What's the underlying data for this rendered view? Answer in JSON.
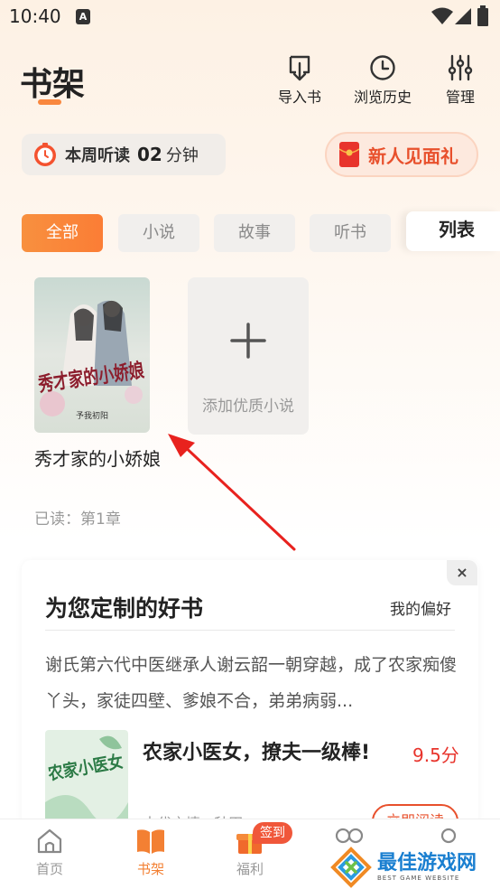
{
  "status_bar": {
    "time": "10:40",
    "notif_icon": "A"
  },
  "header": {
    "title": "书架",
    "actions": [
      {
        "label": "导入书",
        "icon": "import-icon"
      },
      {
        "label": "浏览历史",
        "icon": "history-clock-icon"
      },
      {
        "label": "管理",
        "icon": "sliders-icon"
      }
    ]
  },
  "listen": {
    "label": "本周听读",
    "minutes": "02",
    "unit": "分钟"
  },
  "gift": {
    "label": "新人见面礼"
  },
  "filters": {
    "tabs": [
      "全部",
      "小说",
      "故事",
      "听书"
    ],
    "active": "全部",
    "view_toggle": "列表"
  },
  "shelf": {
    "books": [
      {
        "title": "秀才家的小娇娘",
        "progress": "已读：第1章",
        "cover_title": "秀才家的小娇娘",
        "cover_author": "予我初阳"
      }
    ],
    "add_label": "添加优质小说"
  },
  "recommend": {
    "title": "为您定制的好书",
    "preference": "我的偏好",
    "close": "×",
    "description": "谢氏第六代中医继承人谢云韶一朝穿越，成了农家痴傻丫头，家徒四壁、爹娘不合，弟弟病弱...",
    "book": {
      "title": "农家小医女，撩夫一级棒!",
      "score": "9.5分",
      "meta": "古代言情 · 种田",
      "cover_title": "农家小医女",
      "read_label": "立即阅读"
    }
  },
  "bottom_nav": {
    "items": [
      {
        "label": "首页",
        "icon": "home-icon"
      },
      {
        "label": "书架",
        "icon": "bookshelf-icon",
        "active": true
      },
      {
        "label": "福利",
        "icon": "gift-box-icon",
        "badge": "签到"
      },
      {
        "label": "",
        "icon": "discover-icon"
      },
      {
        "label": "",
        "icon": "profile-icon"
      }
    ]
  },
  "watermark": {
    "name": "最佳游戏网",
    "sub": "BEST GAME WEBSITE"
  },
  "colors": {
    "accent": "#f9873e",
    "red": "#e8502c",
    "score": "#e8342c"
  }
}
